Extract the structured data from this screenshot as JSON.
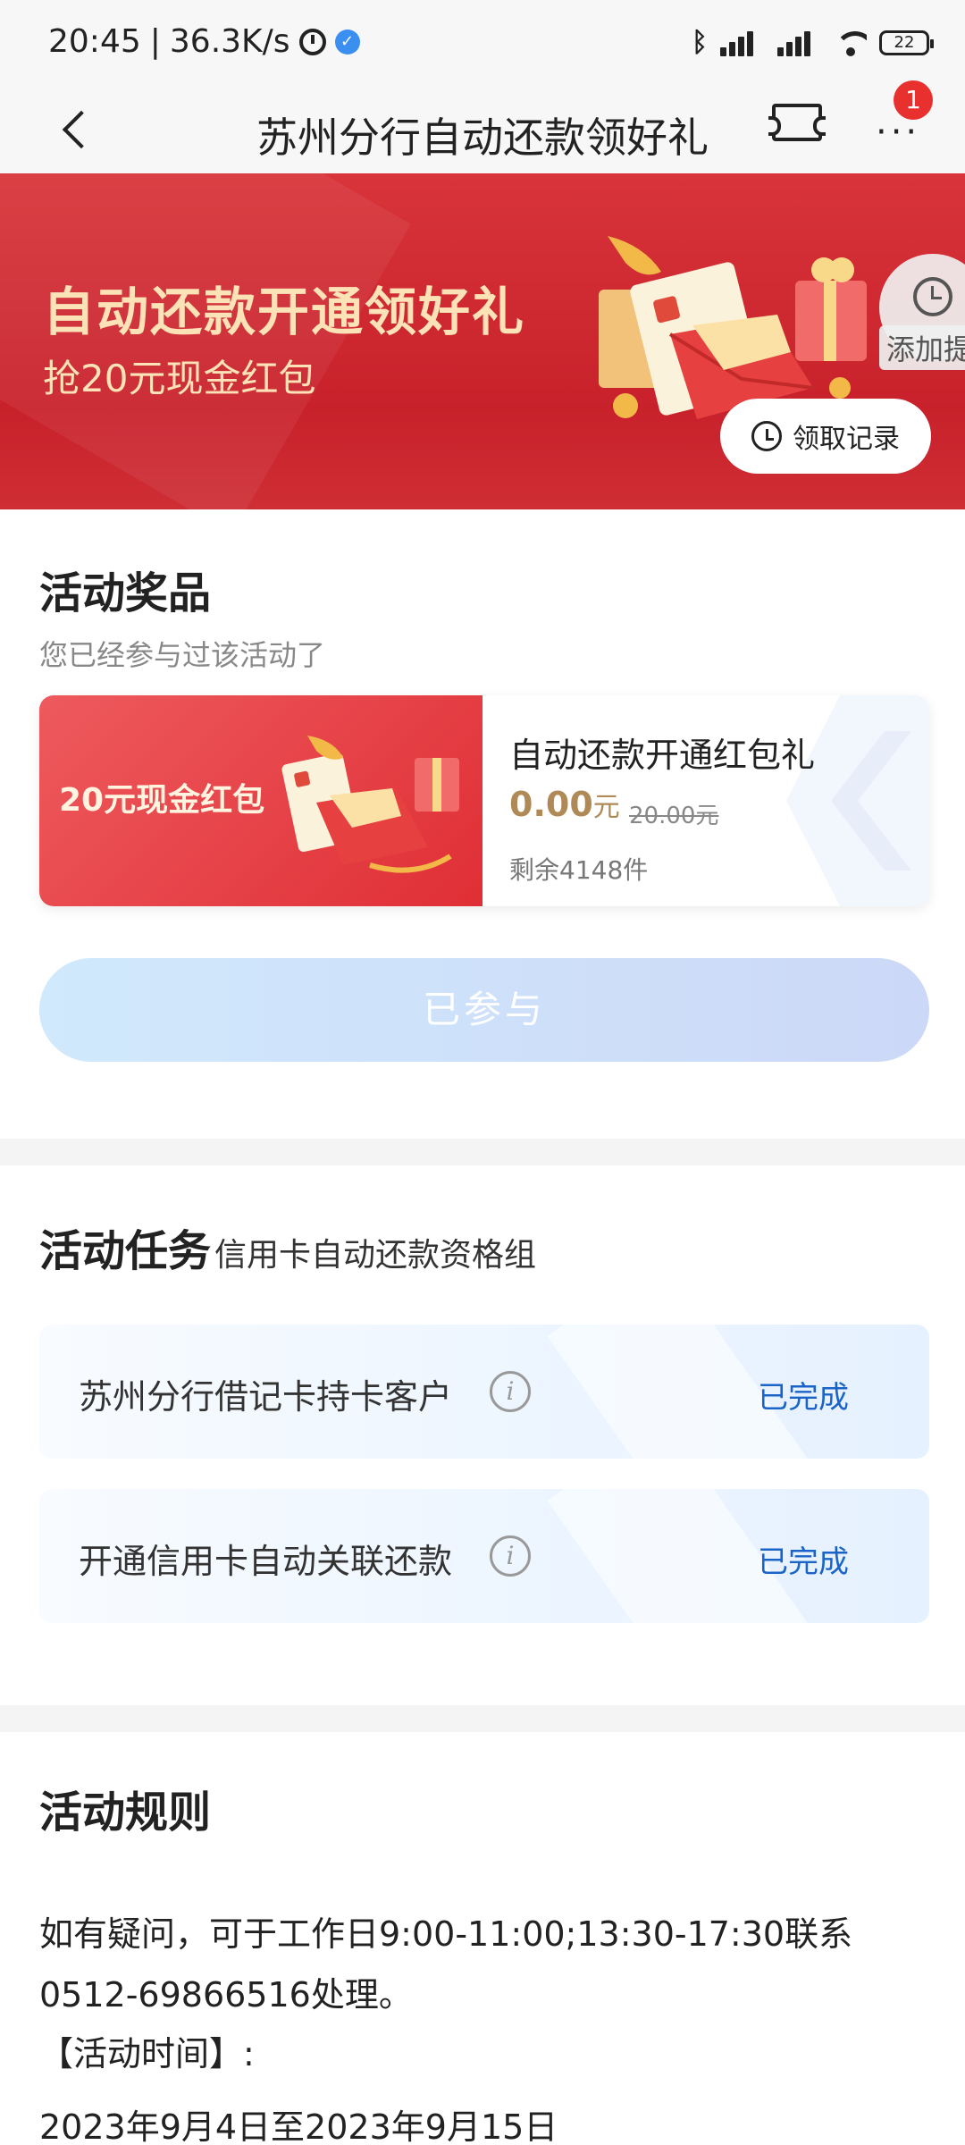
{
  "status_bar": {
    "time": "20:45",
    "speed": "36.3K/s",
    "battery": "22"
  },
  "nav": {
    "title": "苏州分行自动还款领好礼",
    "badge_count": "1"
  },
  "banner": {
    "title": "自动还款开通领好礼",
    "subtitle": "抢20元现金红包",
    "remind_label": "添加提",
    "record_button": "领取记录"
  },
  "prizes": {
    "title": "活动奖品",
    "subtitle": "您已经参与过该活动了",
    "card": {
      "image_label": "20元现金红包",
      "name": "自动还款开通红包礼",
      "price": "0.00",
      "unit": "元",
      "original_price": "20.00元",
      "stock": "剩余4148件"
    },
    "button": "已参与"
  },
  "tasks": {
    "title": "活动任务",
    "subtitle": "信用卡自动还款资格组",
    "items": [
      {
        "label": "苏州分行借记卡持卡客户",
        "status": "已完成"
      },
      {
        "label": "开通信用卡自动关联还款",
        "status": "已完成"
      }
    ]
  },
  "rules": {
    "title": "活动规则",
    "line1": "如有疑问，可于工作日9:00-11:00;13:30-17:30联系0512-69866516处理。",
    "line2": "【活动时间】:",
    "line3": "2023年9月4日至2023年9月15日"
  },
  "colors": {
    "banner_red": "#cd262f",
    "gold_text": "#fbe2b7",
    "link_blue": "#1a64c8",
    "price_gold": "#b08a56",
    "badge_red": "#e8302f"
  }
}
